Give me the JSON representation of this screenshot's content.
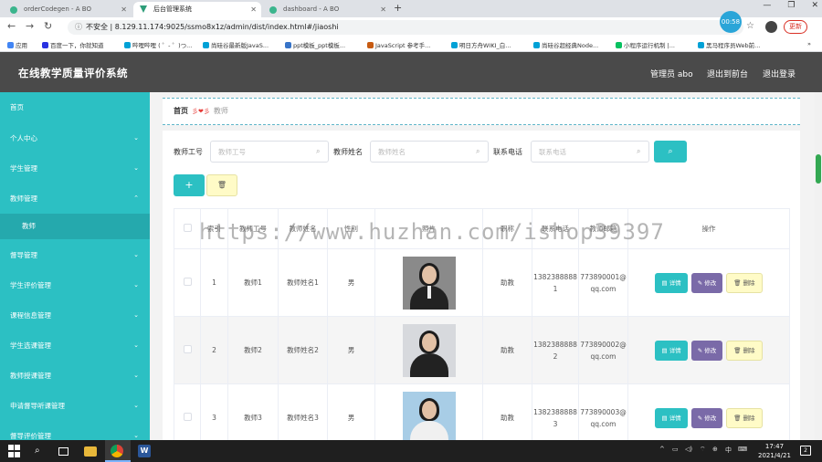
{
  "browser": {
    "tabs": [
      {
        "title": "orderCodegen - A BO"
      },
      {
        "title": "后台管理系统"
      },
      {
        "title": "dashboard - A BO"
      }
    ],
    "security_label": "不安全",
    "url": "8.129.11.174:9025/ssmo8x1z/admin/dist/index.html#/jiaoshi",
    "timer": "00:58",
    "update_label": "更新",
    "bookmarks": [
      "应用",
      "百度一下，你就知道",
      "哔哩哔哩 ( ゜- ゜)つ...",
      "尚硅谷最新版JavaS...",
      "ppt模板_ppt模板...",
      "JavaScript 参考手...",
      "明日方舟WIKI_白...",
      "尚硅谷超经典Node...",
      "小程序运行机制 |...",
      "黑马程序员Web前..."
    ]
  },
  "header": {
    "title": "在线教学质量评价系统",
    "user": "管理员 abo",
    "back_to_front": "退出到前台",
    "logout": "退出登录"
  },
  "sidebar": {
    "items": [
      {
        "label": "首页",
        "chevron": ""
      },
      {
        "label": "个人中心",
        "chevron": "⌄"
      },
      {
        "label": "学生管理",
        "chevron": "⌄"
      },
      {
        "label": "教师管理",
        "chevron": "⌃"
      },
      {
        "label": "教师",
        "sub": true
      },
      {
        "label": "督导管理",
        "chevron": "⌄"
      },
      {
        "label": "学生评价管理",
        "chevron": "⌄"
      },
      {
        "label": "课程信息管理",
        "chevron": "⌄"
      },
      {
        "label": "学生选课管理",
        "chevron": "⌄"
      },
      {
        "label": "教师授课管理",
        "chevron": "⌄"
      },
      {
        "label": "申请督导听课管理",
        "chevron": "⌄"
      },
      {
        "label": "督导评价管理",
        "chevron": "⌄"
      }
    ]
  },
  "breadcrumb": {
    "home": "首页",
    "separator": "彡❤彡",
    "current": "教师"
  },
  "search": {
    "fields": [
      {
        "label": "教师工号",
        "placeholder": "教师工号"
      },
      {
        "label": "教师姓名",
        "placeholder": "教师姓名"
      },
      {
        "label": "联系电话",
        "placeholder": "联系电话"
      }
    ]
  },
  "toolbar": {
    "add_icon": "+",
    "delete_icon": "🗑"
  },
  "table": {
    "headers": [
      "",
      "索引",
      "教师工号",
      "教师姓名",
      "性别",
      "照片",
      "职称",
      "联系电话",
      "教师邮箱",
      "操作"
    ],
    "rows": [
      {
        "index": "1",
        "id": "教师1",
        "name": "教师姓名1",
        "gender": "男",
        "title": "助教",
        "phone": "13823888881",
        "email": "773890001@qq.com"
      },
      {
        "index": "2",
        "id": "教师2",
        "name": "教师姓名2",
        "gender": "男",
        "title": "助教",
        "phone": "13823888882",
        "email": "773890002@qq.com"
      },
      {
        "index": "3",
        "id": "教师3",
        "name": "教师姓名3",
        "gender": "男",
        "title": "助教",
        "phone": "13823888883",
        "email": "773890003@qq.com"
      }
    ],
    "actions": {
      "detail": "详情",
      "edit": "修改",
      "delete": "删除"
    }
  },
  "watermark": "https://www.huzhan.com/ishop39397",
  "taskbar": {
    "word_label": "W",
    "ime": "中",
    "time": "17:47",
    "date": "2021/4/21",
    "notif_count": "2"
  }
}
